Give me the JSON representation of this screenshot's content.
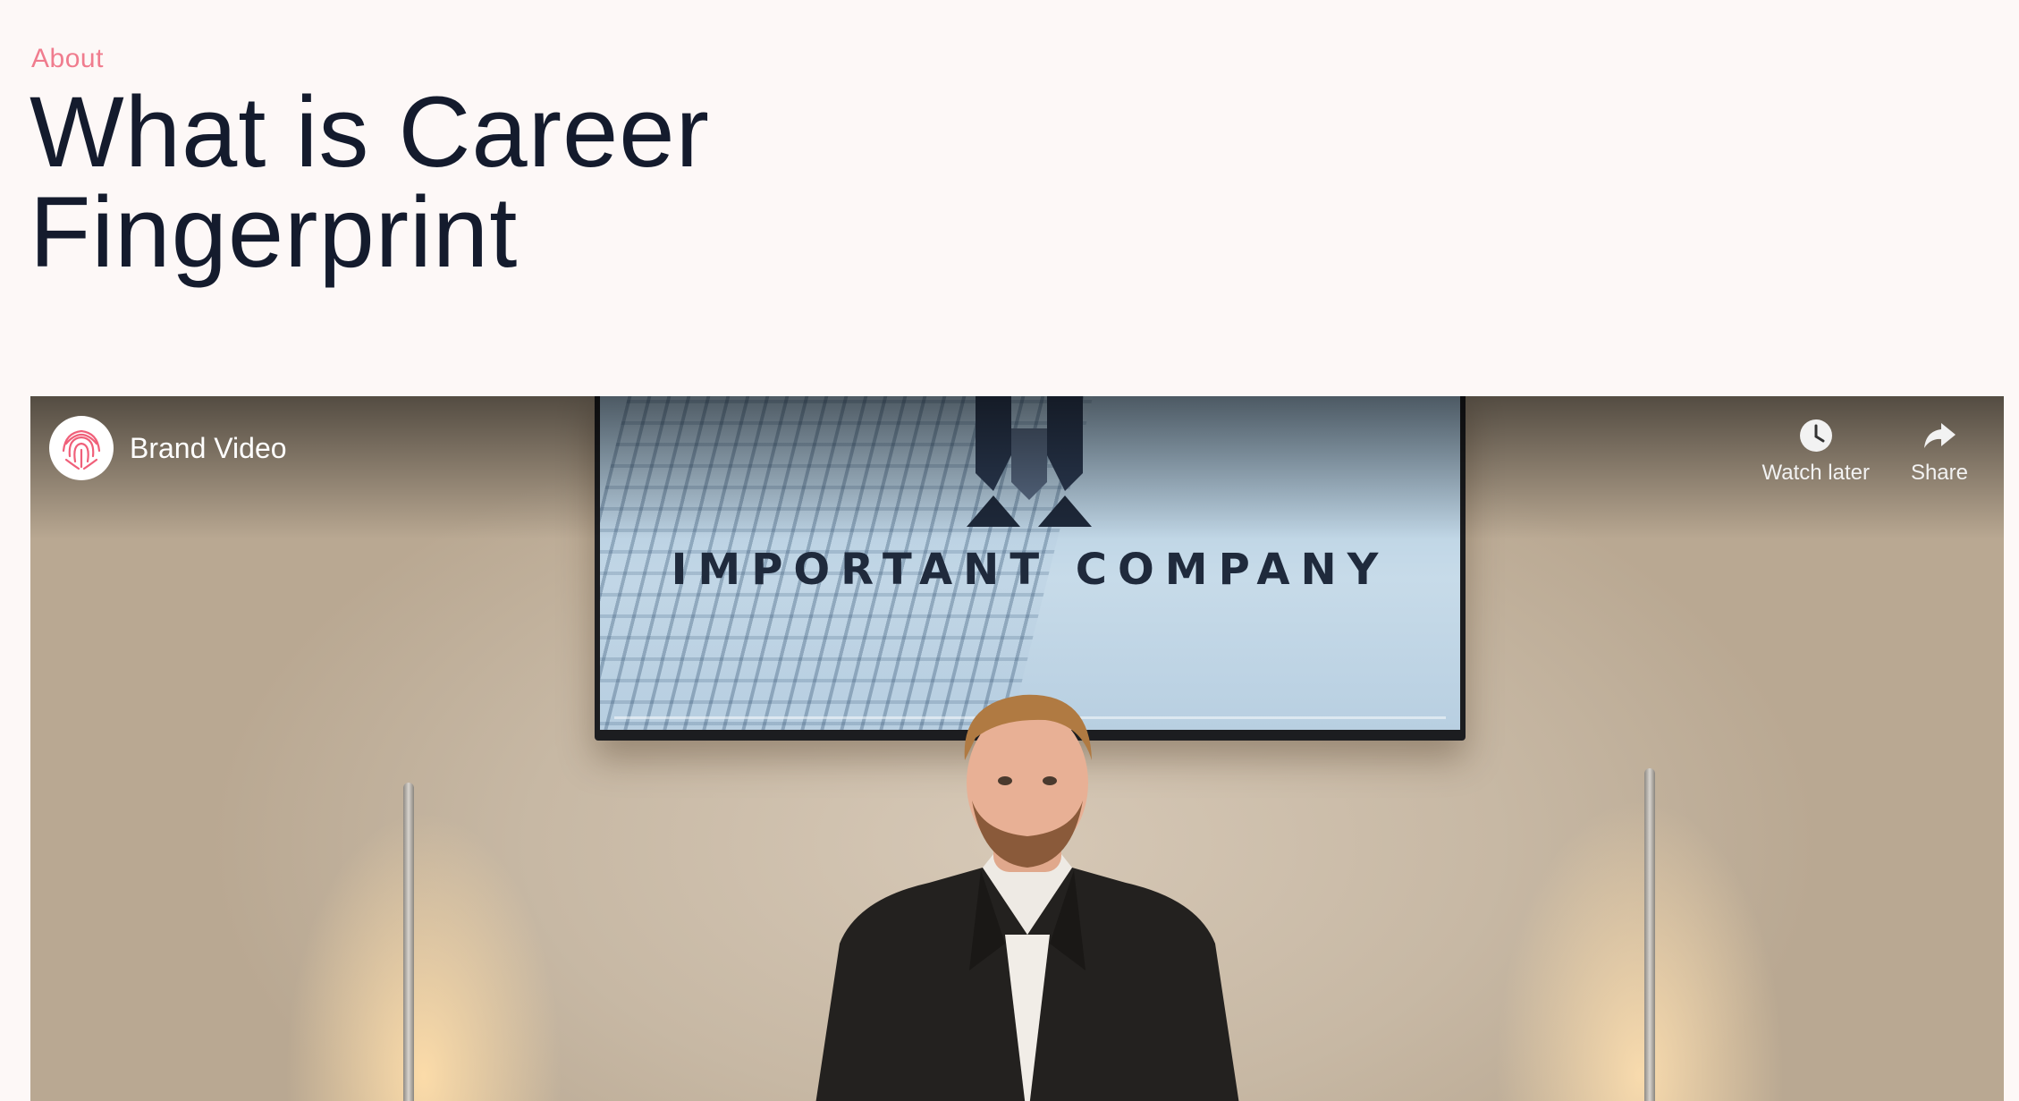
{
  "section": {
    "eyebrow": "About",
    "title_line1": "What is Career",
    "title_line2": "Fingerprint"
  },
  "video": {
    "channel_title": "Brand Video",
    "actions": {
      "watch_later": "Watch later",
      "share": "Share"
    },
    "screen_text": "IMPORTANT COMPANY",
    "icons": [
      "fingerprint-icon",
      "clock-icon",
      "share-arrow-icon"
    ]
  },
  "colors": {
    "background": "#fdf8f7",
    "eyebrow": "#f07c8e",
    "heading": "#141b2d",
    "brand_pink": "#f0607a"
  }
}
